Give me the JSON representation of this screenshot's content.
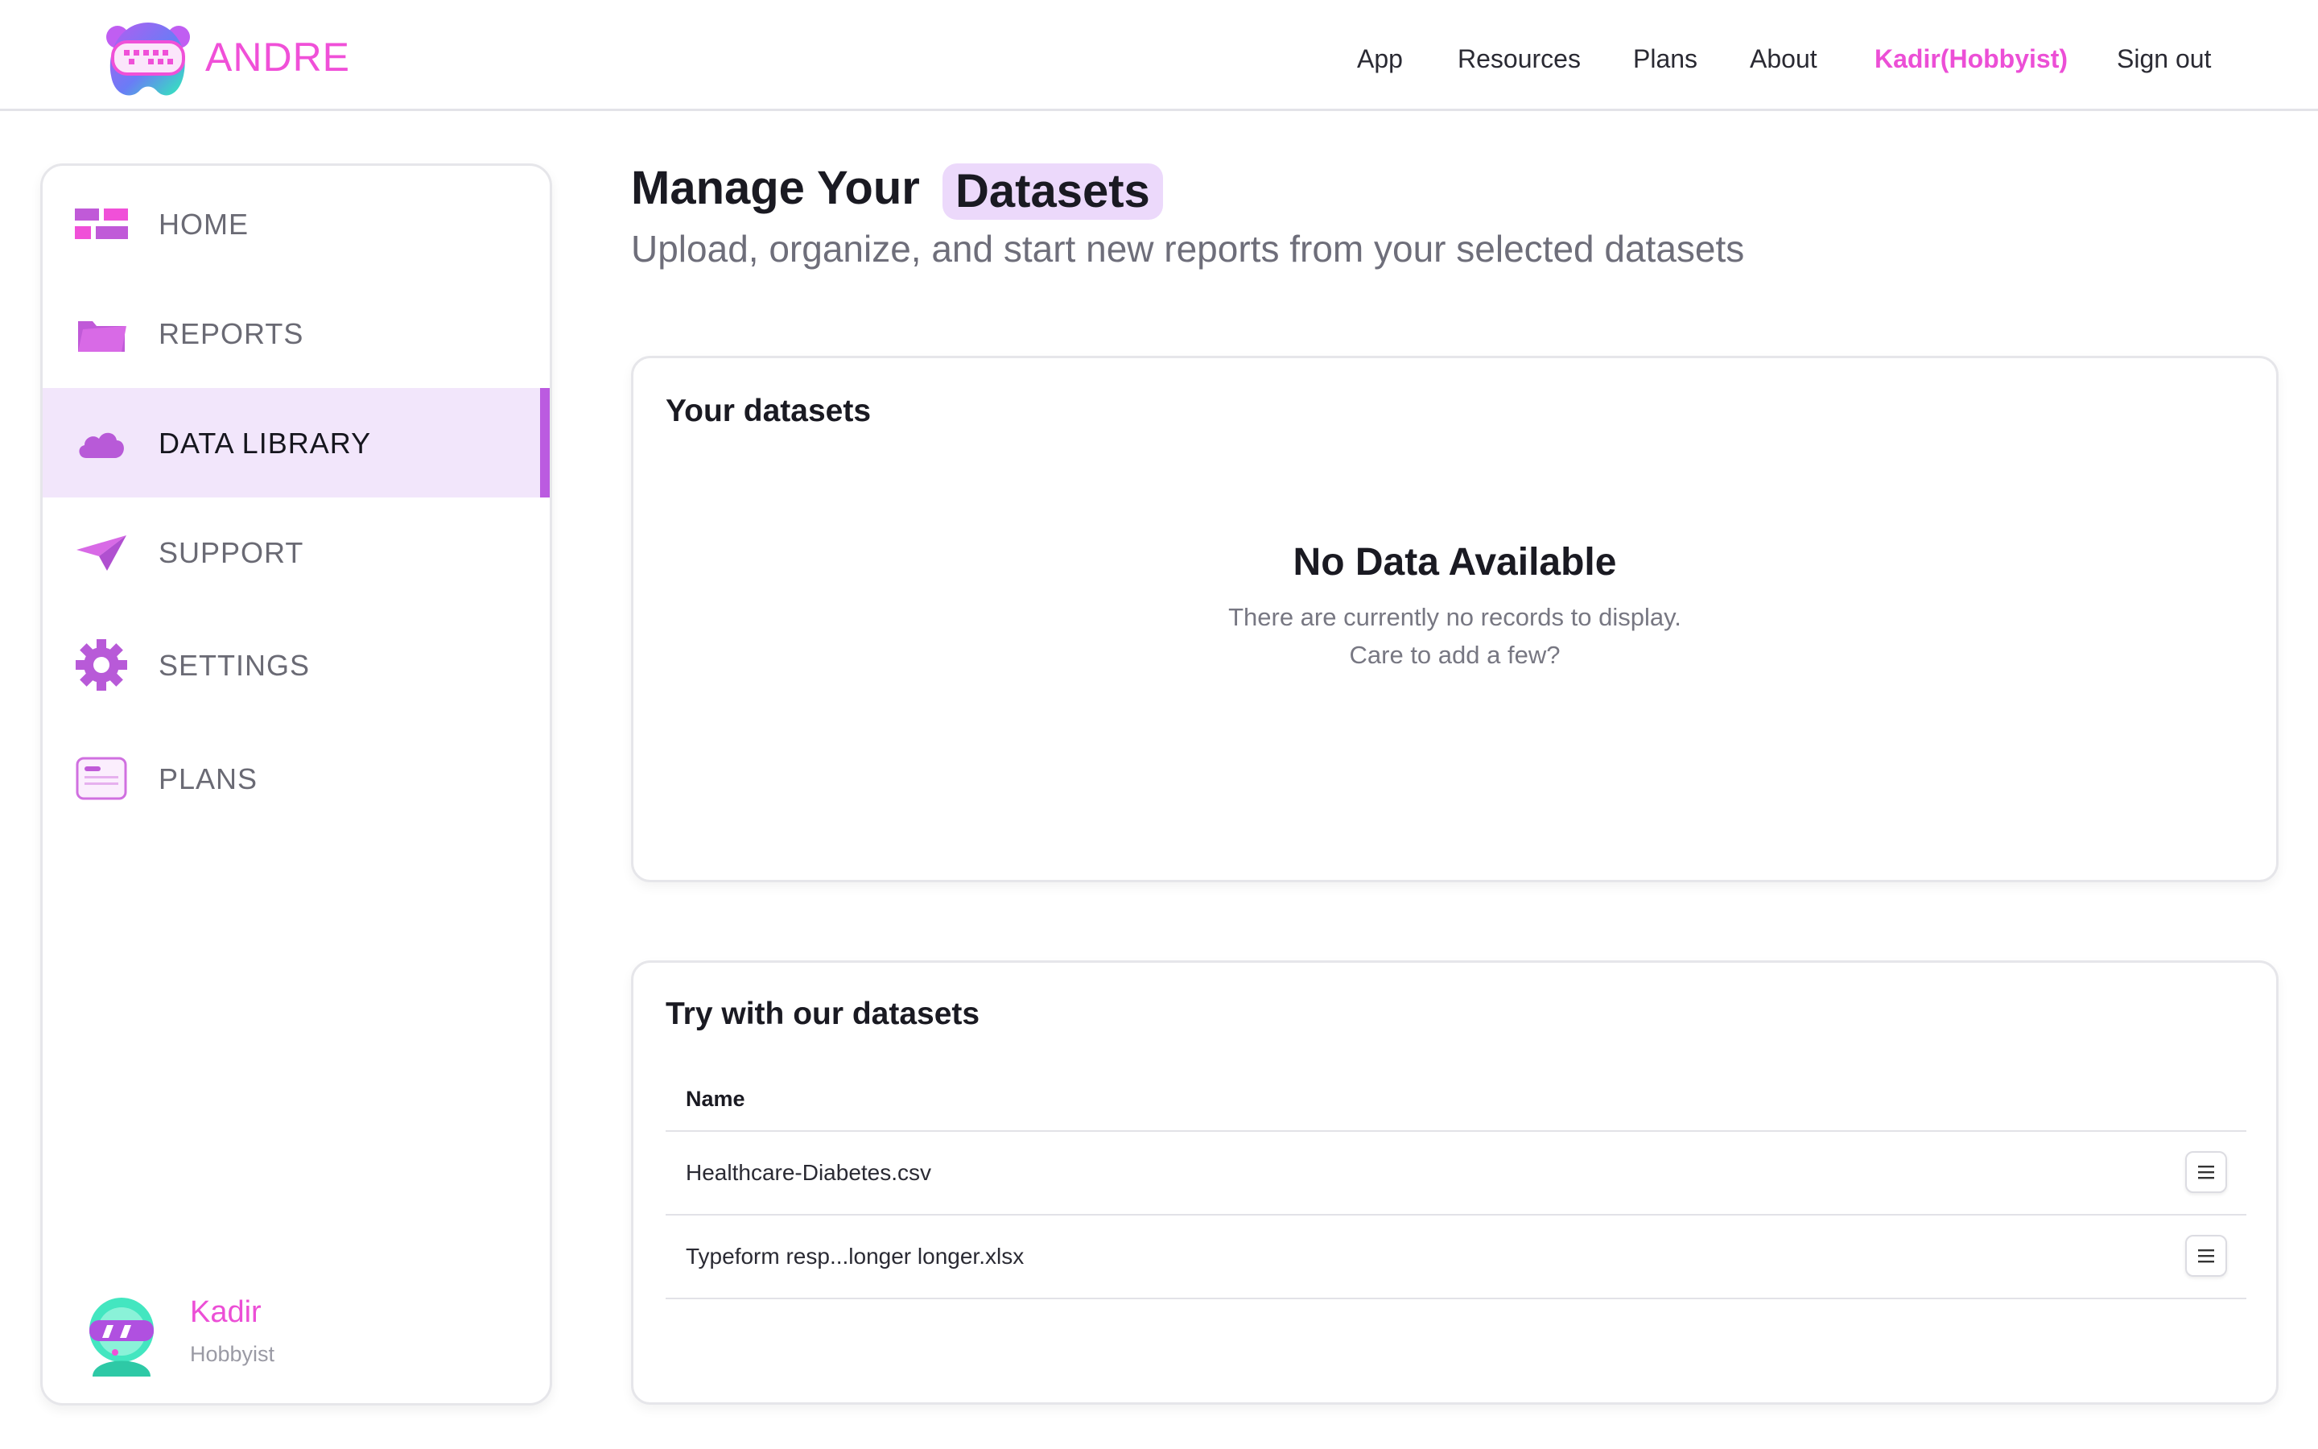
{
  "brand": {
    "name": "ANDRE",
    "primary_color": "#f050d8",
    "accent_color": "#bb5be0"
  },
  "topnav": {
    "items": [
      {
        "label": "App"
      },
      {
        "label": "Resources"
      },
      {
        "label": "Plans"
      },
      {
        "label": "About"
      },
      {
        "label": "Kadir(Hobbyist)"
      },
      {
        "label": "Sign out"
      }
    ]
  },
  "sidebar": {
    "items": [
      {
        "label": "HOME",
        "icon": "dashboard-icon"
      },
      {
        "label": "REPORTS",
        "icon": "folder-icon"
      },
      {
        "label": "DATA LIBRARY",
        "icon": "cloud-icon",
        "active": true
      },
      {
        "label": "SUPPORT",
        "icon": "paper-plane-icon"
      },
      {
        "label": "SETTINGS",
        "icon": "gear-icon"
      },
      {
        "label": "PLANS",
        "icon": "card-icon"
      }
    ],
    "profile": {
      "name": "Kadir",
      "plan": "Hobbyist"
    }
  },
  "page": {
    "title_prefix": "Manage Your",
    "title_highlight": "Datasets",
    "subtitle": "Upload, organize, and start new reports from your selected datasets"
  },
  "your_datasets": {
    "title": "Your datasets",
    "empty_title": "No Data Available",
    "empty_line1": "There are currently no records to display.",
    "empty_line2": "Care to add a few?"
  },
  "sample_datasets": {
    "title": "Try with our datasets",
    "column_name": "Name",
    "rows": [
      {
        "name": "Healthcare-Diabetes.csv",
        "action_icon": "menu-icon"
      },
      {
        "name": "Typeform resp...longer longer.xlsx",
        "action_icon": "menu-icon"
      }
    ]
  }
}
